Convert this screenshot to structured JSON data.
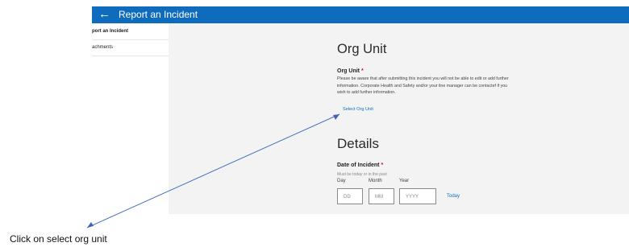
{
  "header": {
    "back_glyph": "←",
    "title": "Report an Incident"
  },
  "sidebar": {
    "items": [
      {
        "label": "port an Incident",
        "active": true
      },
      {
        "label": "achments",
        "active": false
      }
    ]
  },
  "org_unit": {
    "heading": "Org Unit",
    "field_label": "Org Unit",
    "required_mark": "*",
    "info_line1": "Please be aware that after submitting this incident you will not be able to edit or add further",
    "info_line2": "information. Corporate Health and Safety and/or your line manager can be contactef if you",
    "info_line3": "wish to add further information.",
    "select_link": "Select Org Unit"
  },
  "details": {
    "heading": "Details",
    "date_label": "Date of Incident",
    "required_mark": "*",
    "hint": "Must be today or in the past",
    "day_label": "Day",
    "month_label": "Month",
    "year_label": "Year",
    "day_placeholder": "DD",
    "month_placeholder": "MM",
    "year_placeholder": "YYYY",
    "today_link": "Today"
  },
  "annotation": {
    "text": "Click on select org unit",
    "arrow_color": "#4a72c4"
  },
  "colors": {
    "header_bg": "#0f6cbd",
    "link": "#0f6cbd",
    "required": "#c50f1f",
    "main_bg": "#f3f3f3"
  }
}
